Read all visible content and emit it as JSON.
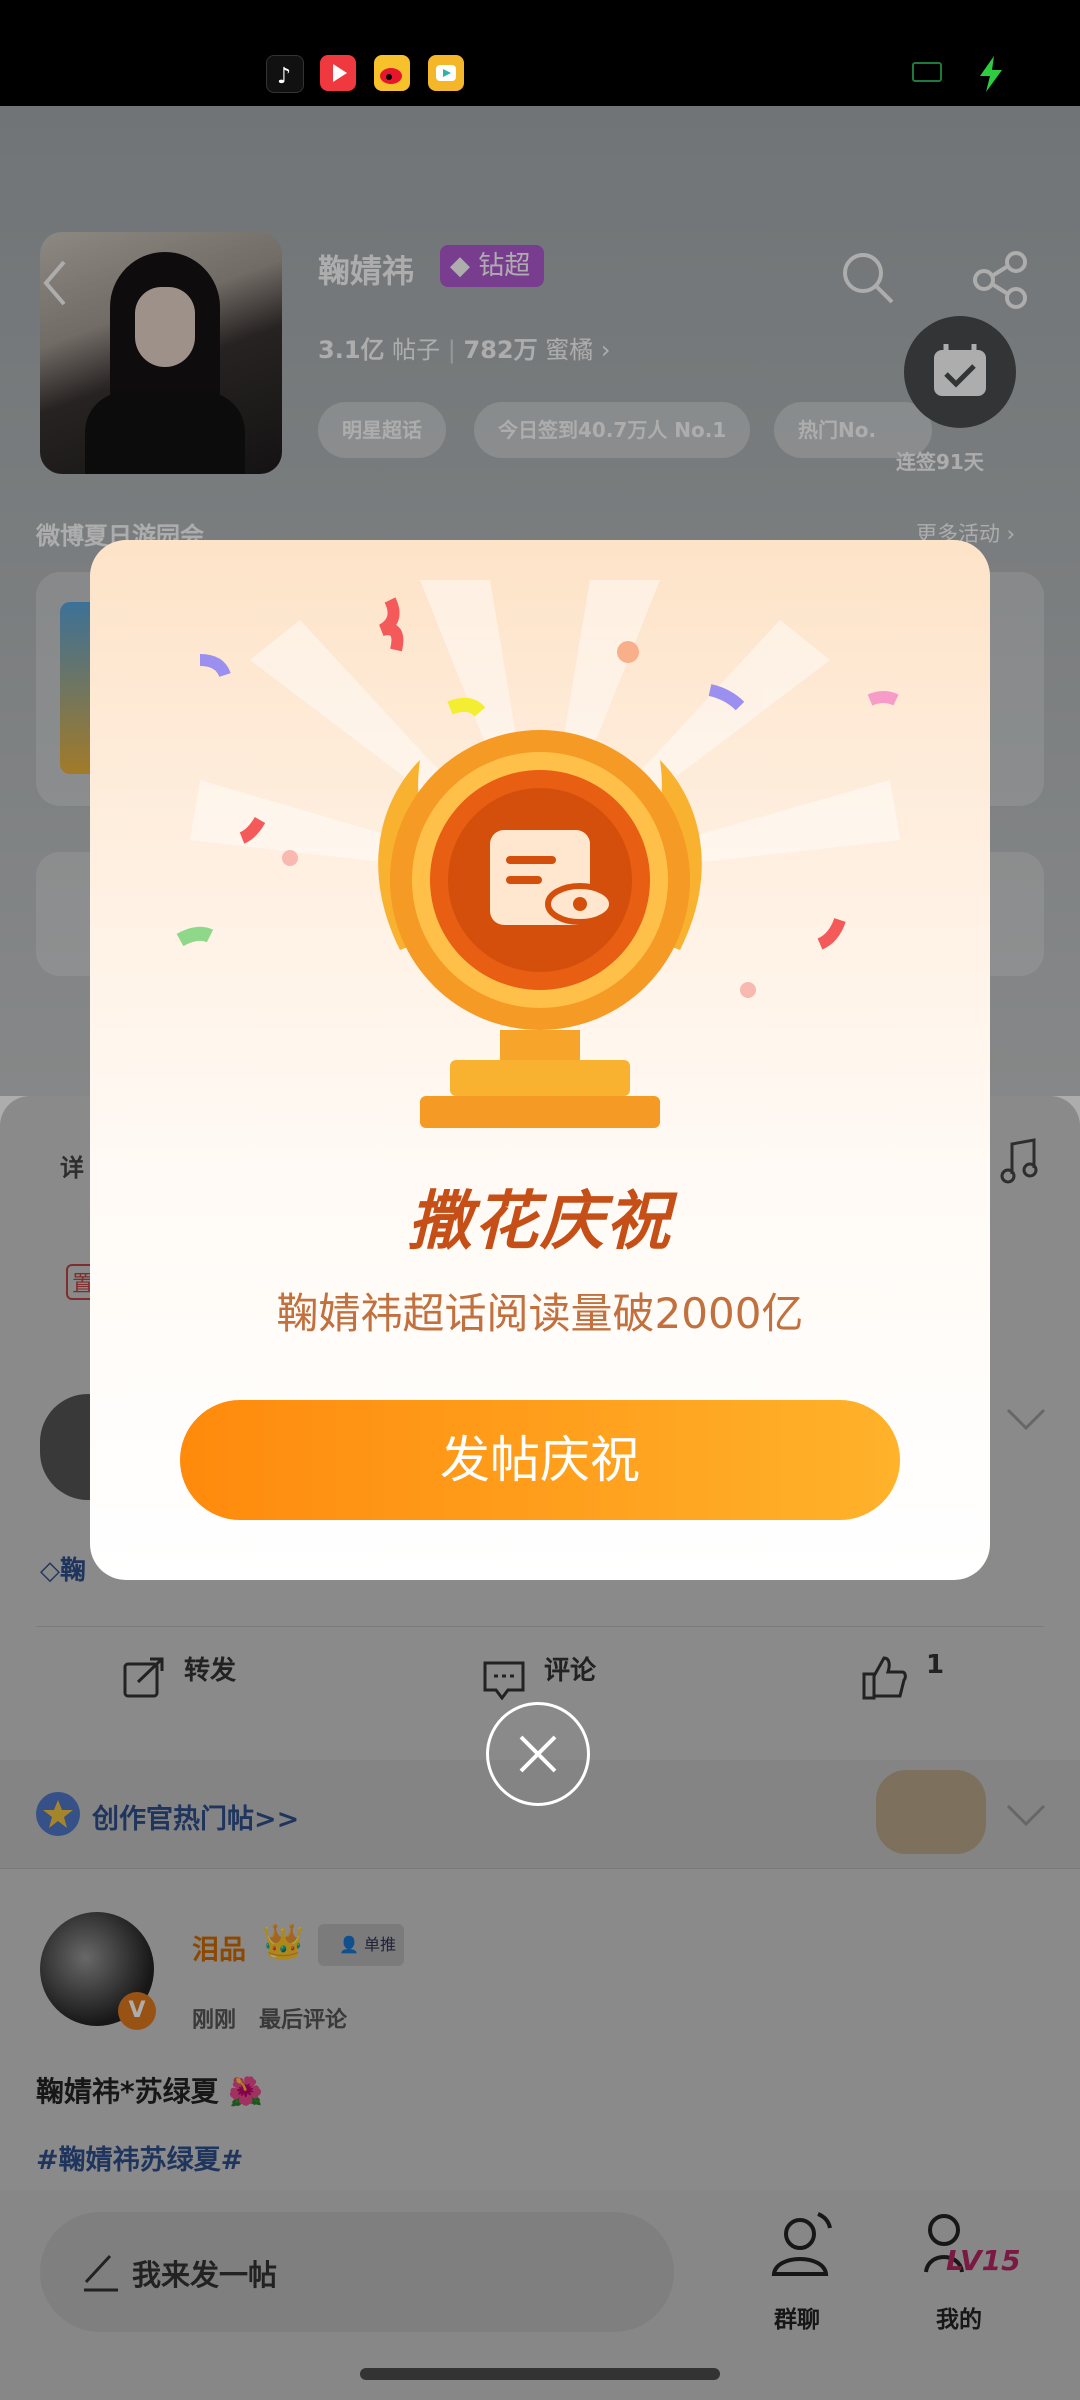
{
  "status_bar": {
    "apps": [
      "tiktok-icon",
      "video-icon",
      "weibo-icon",
      "camera-app-icon"
    ]
  },
  "header": {
    "title": "鞠婧祎",
    "badge": "钻超",
    "stat1_value": "3.1亿",
    "stat1_label": "帖子",
    "stat2_value": "782万",
    "stat2_label": "蜜橘",
    "chips": [
      "明星超话",
      "今日签到40.7万人  No.1",
      "热门No."
    ],
    "checkin_label": "连签91天",
    "section_title": "微博夏日游园会",
    "section_more": "更多活动"
  },
  "behind": {
    "tab_left": "详",
    "rank_left": "置",
    "badge_left": "鞠",
    "repost": "转发",
    "comment": "评论",
    "like_count": "1",
    "creator_label": "创作官热门帖>>",
    "post_user": "泪品",
    "post_tag": "单推",
    "post_level": "V",
    "post_time": "刚刚",
    "post_last": "最后评论",
    "post_text": "鞠婧祎*苏绿夏",
    "post_topic": "#鞠婧祎苏绿夏#",
    "compose": "我来发一帖",
    "nav_group": "群聊",
    "nav_me": "我的",
    "level": "LV15"
  },
  "modal": {
    "heading": "撒花庆祝",
    "subtitle": "鞠婧祎超话阅读量破2000亿",
    "cta": "发帖庆祝"
  },
  "colors": {
    "accent": "#ff8a0c",
    "heading": "#c54f16",
    "badge": "#b35bd4"
  }
}
